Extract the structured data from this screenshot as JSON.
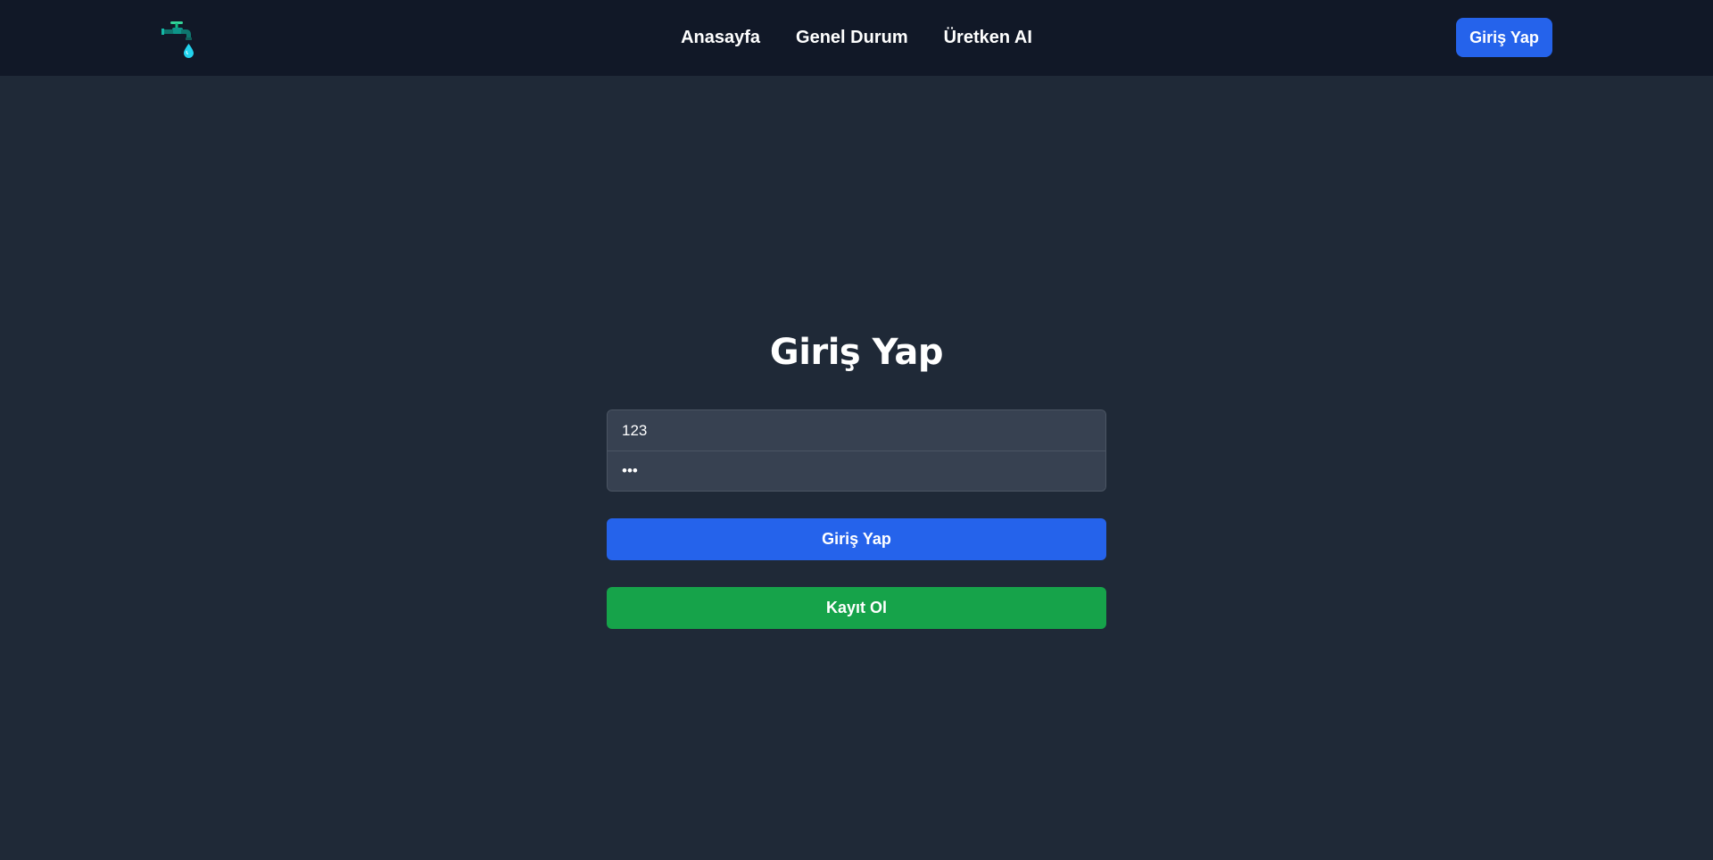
{
  "nav": {
    "logo_icon": "water-faucet-icon",
    "links": [
      "Anasayfa",
      "Genel Durum",
      "Üretken AI"
    ],
    "login_button": "Giriş Yap"
  },
  "login": {
    "title": "Giriş Yap",
    "username_value": "123",
    "password_value": "123",
    "submit_label": "Giriş Yap",
    "register_label": "Kayıt Ol"
  },
  "colors": {
    "nav_bg": "#111827",
    "page_bg": "#1f2937",
    "primary": "#2563eb",
    "success": "#16a34a",
    "input_bg": "#374151"
  }
}
